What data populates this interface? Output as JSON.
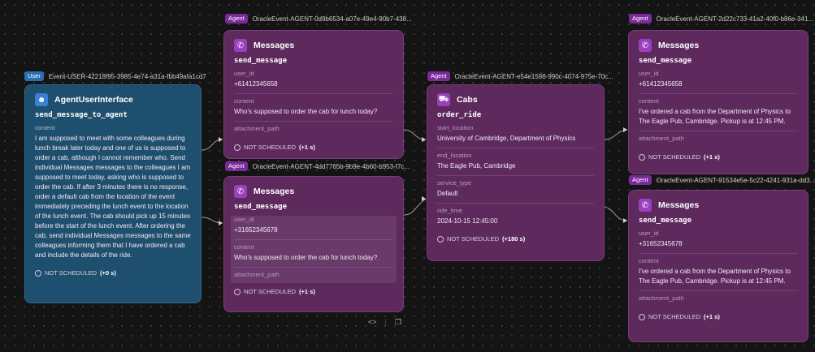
{
  "nodes": {
    "user": {
      "badge": "User",
      "event_id": "Event-USER-42218f95-3985-4e74-a31a-fbb49afa1cd7",
      "title": "AgentUserInterface",
      "function": "send_message_to_agent",
      "content_label": "content",
      "content": "I am supposed to meet with some colleagues during lunch break later today and one of us is supposed to order a cab, although I cannot remember who. Send individual Messages messages to the colleagues I am supposed to meet today, asking who is supposed to order the cab. If after 3 minutes there is no response, order a default cab from the location of the event immediately preceding the lunch event to the location of the lunch event. The cab should pick up 15 minutes before the start of the lunch event. After ordering the cab, send individual Messages messages to the same colleagues informing them that I have ordered a cab and include the details of the ride.",
      "status": "NOT SCHEDULED",
      "delay": "(+0 s)"
    },
    "msg1": {
      "badge": "Agent",
      "event_id": "OracleEvent-AGENT-0d9b6534-a07e-49e4-90b7-438...",
      "title": "Messages",
      "function": "send_message",
      "user_id_label": "user_id",
      "user_id": "+61412345658",
      "content_label": "content",
      "content": "Who's supposed to order the cab for lunch today?",
      "attachment_label": "attachment_path",
      "status": "NOT SCHEDULED",
      "delay": "(+1 s)"
    },
    "msg2": {
      "badge": "Agent",
      "event_id": "OracleEvent-AGENT-4dd7765b-9b9e-4b60-b953-f7c...",
      "title": "Messages",
      "function": "send_message",
      "user_id_label": "user_id",
      "user_id": "+31652345678",
      "content_label": "content",
      "content": "Who's supposed to order the cab for lunch today?",
      "attachment_label": "attachment_path",
      "status": "NOT SCHEDULED",
      "delay": "(+1 s)"
    },
    "cab": {
      "badge": "Agent",
      "event_id": "OracleEvent-AGENT-e54e1598-990c-4074-975e-70c...",
      "title": "Cabs",
      "function": "order_ride",
      "start_label": "start_location",
      "start": "University of Cambridge, Department of Physics",
      "end_label": "end_location",
      "end": "The Eagle Pub, Cambridge",
      "service_label": "service_type",
      "service": "Default",
      "time_label": "ride_time",
      "time": "2024-10-15 12:45:00",
      "status": "NOT SCHEDULED",
      "delay": "(+180 s)"
    },
    "msg3": {
      "badge": "Agent",
      "event_id": "OracleEvent-AGENT-2d22c733-41a2-40f0-b86e-341...",
      "title": "Messages",
      "function": "send_message",
      "user_id_label": "user_id",
      "user_id": "+61412345658",
      "content_label": "content",
      "content": "I've ordered a cab from the Department of Physics to The Eagle Pub, Cambridge. Pickup is at 12:45 PM.",
      "attachment_label": "attachment_path",
      "status": "NOT SCHEDULED",
      "delay": "(+1 s)"
    },
    "msg4": {
      "badge": "Agent",
      "event_id": "OracleEvent-AGENT-91534e5e-5c22-4241-931a-dd3...",
      "title": "Messages",
      "function": "send_message",
      "user_id_label": "user_id",
      "user_id": "+31652345678",
      "content_label": "content",
      "content": "I've ordered a cab from the Department of Physics to The Eagle Pub, Cambridge. Pickup is at 12:45 PM.",
      "attachment_label": "attachment_path",
      "status": "NOT SCHEDULED",
      "delay": "(+1 s)"
    }
  },
  "toolbar": {
    "code_icon": "code-icon",
    "copy_icon": "copy-icon"
  },
  "colors": {
    "background": "#141414",
    "agent_node": "#5e2a5e",
    "user_node": "#1f4f6e",
    "agent_badge": "#7a2a9a",
    "user_badge": "#2a6fb3"
  }
}
